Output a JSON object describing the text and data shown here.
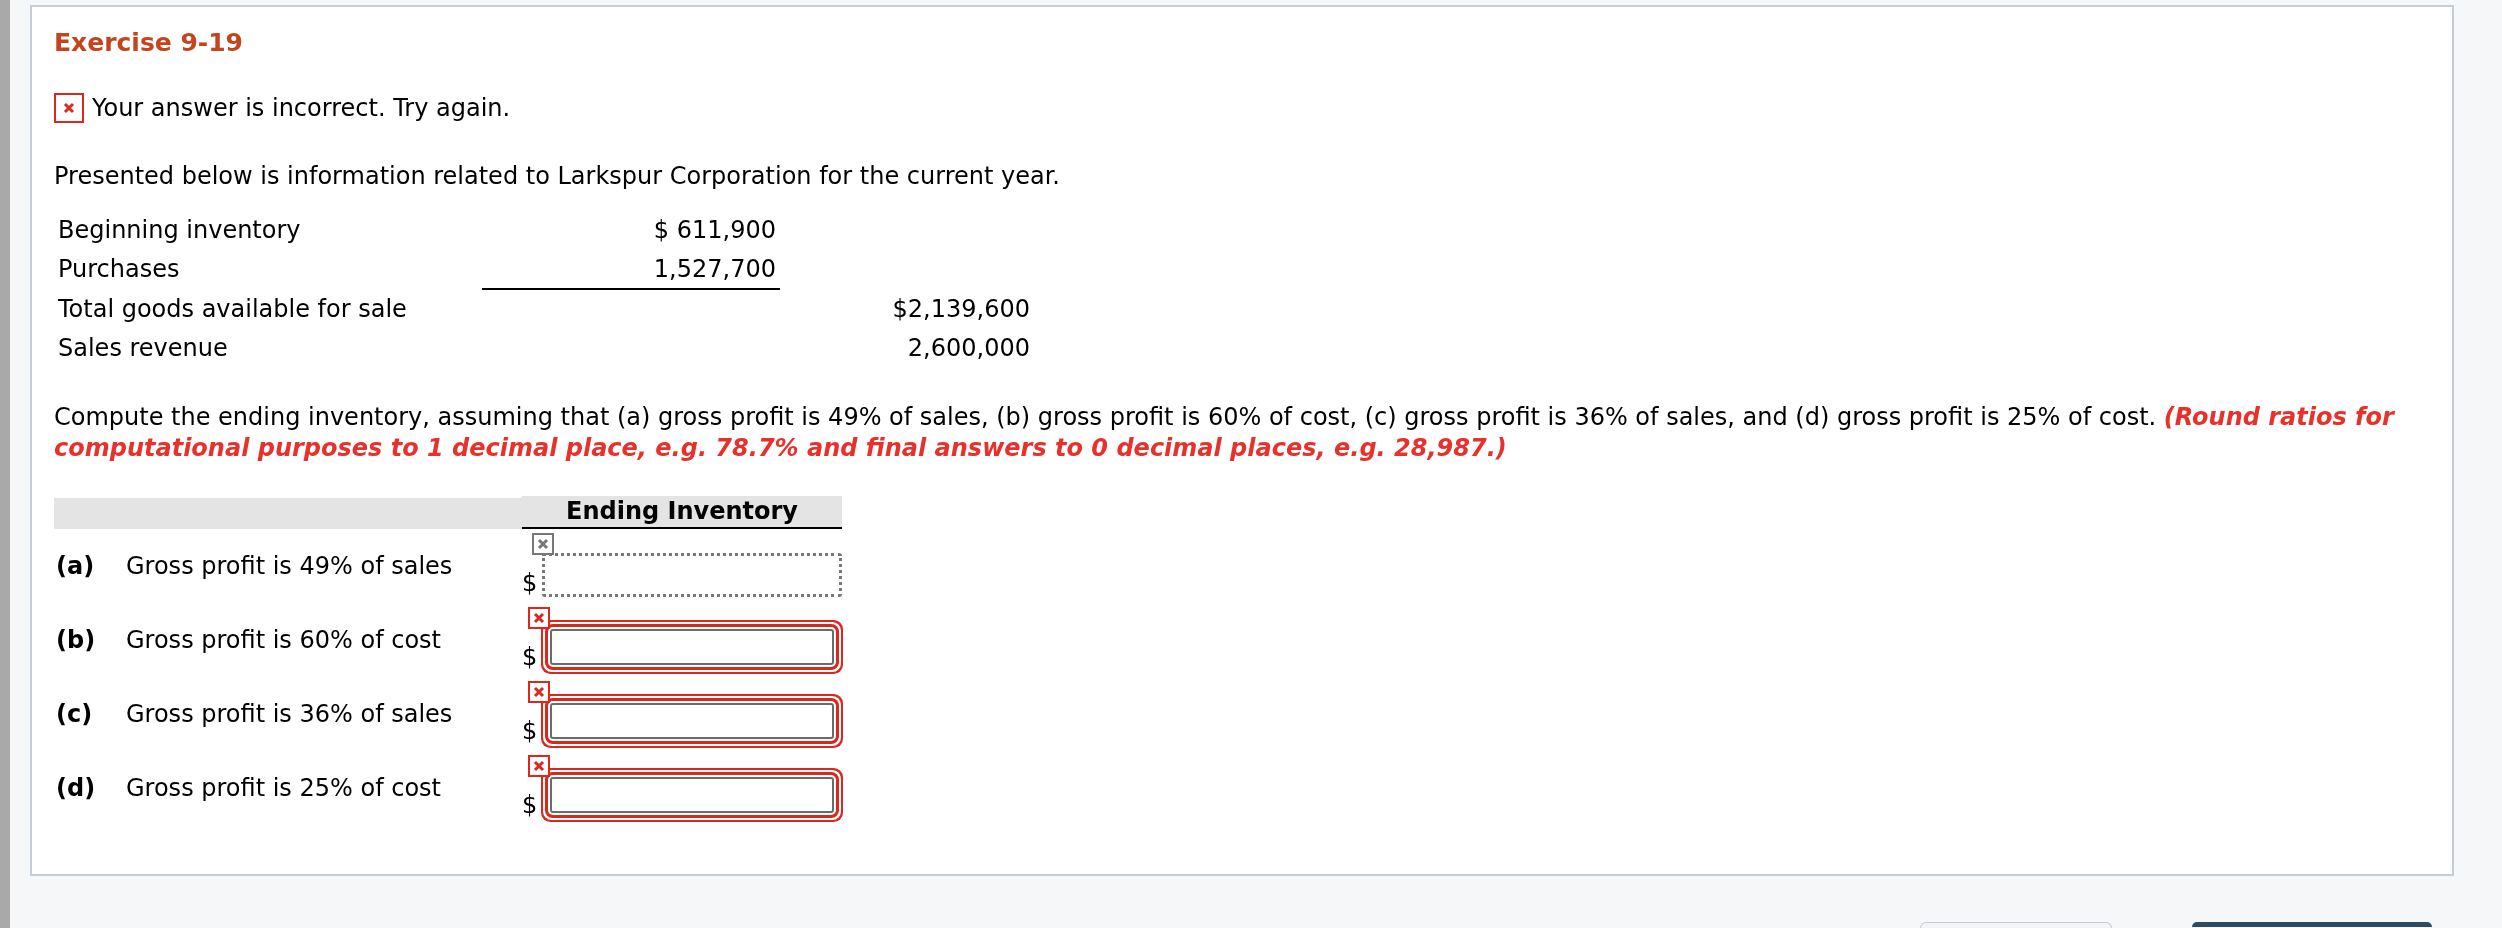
{
  "exercise": {
    "title": "Exercise 9-19"
  },
  "feedback": {
    "text": "Your answer is incorrect.  Try again.",
    "correct": false
  },
  "intro": "Presented below is information related to Larkspur Corporation for the current year.",
  "data_table": {
    "rows": [
      {
        "label": "Beginning inventory",
        "column_2": "$ 611,900",
        "underlined": false
      },
      {
        "label": "Purchases",
        "column_2": "1,527,700",
        "underlined": true
      },
      {
        "label": "Total goods available for sale",
        "column_3": "$2,139,600",
        "underlined": false
      },
      {
        "label": "Sales revenue",
        "column_3": "2,600,000",
        "underlined": false
      }
    ]
  },
  "instructions": {
    "text": "Compute the ending inventory, assuming that (a) gross profit is 49% of sales, (b) gross profit is 60% of cost, (c) gross profit is 36% of sales, and (d) gross profit is 25% of cost.",
    "note": "(Round ratios for computational purposes to 1 decimal place, e.g. 78.7% and final answers to 0 decimal places, e.g. 28,987.)"
  },
  "answers": {
    "header": "Ending Inventory",
    "rows": [
      {
        "letter": "(a)",
        "label": "Gross profit is 49% of sales",
        "currency": "$",
        "incorrect": false
      },
      {
        "letter": "(b)",
        "label": "Gross profit is 60% of cost",
        "currency": "$",
        "incorrect": true
      },
      {
        "letter": "(c)",
        "label": "Gross profit is 36% of sales",
        "currency": "$",
        "incorrect": true
      },
      {
        "letter": "(d)",
        "label": "Gross profit is 25% of cost",
        "currency": "$",
        "incorrect": true
      }
    ]
  }
}
